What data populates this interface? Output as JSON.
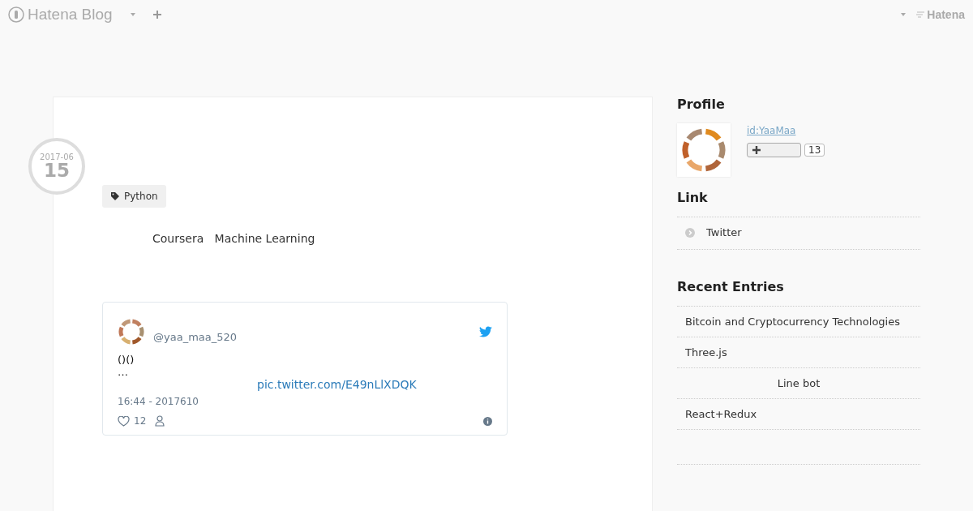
{
  "header": {
    "logo": "Hatena Blog",
    "brand": "Hatena"
  },
  "entry": {
    "date": {
      "year_month": "2017-06",
      "day": "15"
    },
    "tags": [
      "Python"
    ],
    "title": "Coursera   Machine Learning",
    "tweet": {
      "handle": "@yaa_maa_520",
      "text": [
        "()()",
        "…"
      ],
      "link": "pic.twitter.com/E49nLlXDQK",
      "time": "16:44 - 2017610",
      "likes": "12"
    }
  },
  "sidebar": {
    "profile": {
      "heading": "Profile",
      "user_id": "id:YaaMaa",
      "count": "13"
    },
    "link": {
      "heading": "Link",
      "items": [
        "Twitter"
      ]
    },
    "recent": {
      "heading": "Recent Entries",
      "items": [
        {
          "title": "Bitcoin and Cryptocurrency Technologies",
          "kind": "plain"
        },
        {
          "title": "Three.js",
          "kind": "plain"
        },
        {
          "title": "Line bot",
          "kind": "centered"
        },
        {
          "title": "React+Redux",
          "kind": "plain"
        }
      ]
    }
  }
}
